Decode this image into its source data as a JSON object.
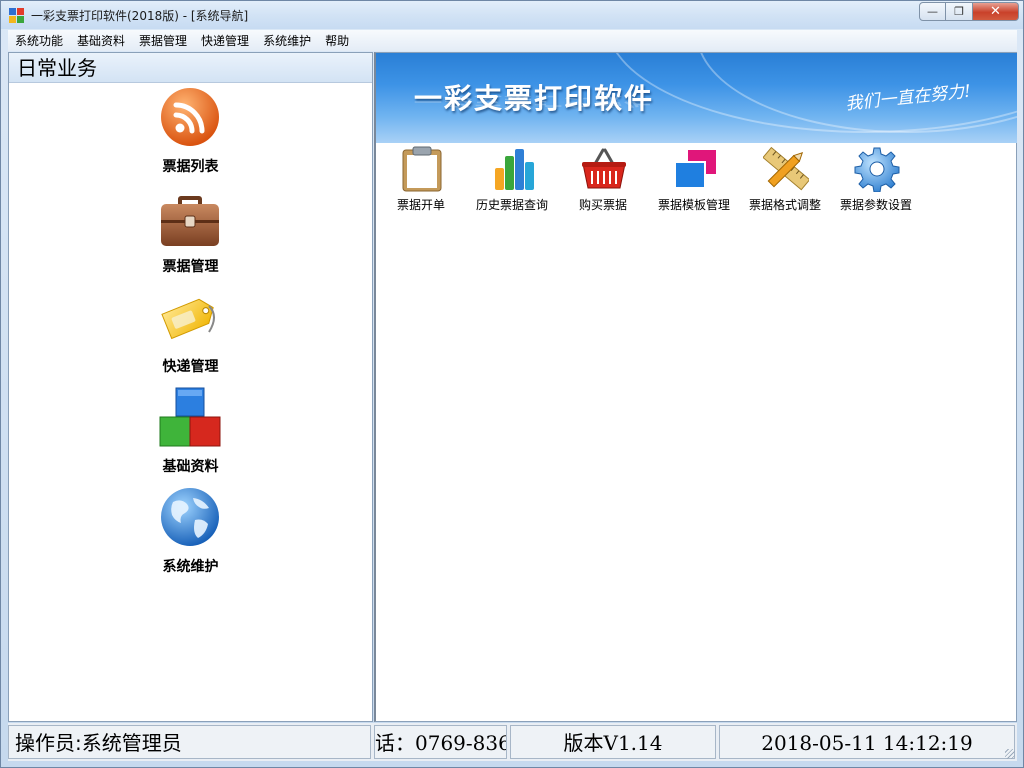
{
  "window": {
    "title": "一彩支票打印软件(2018版) - [系统导航]"
  },
  "menu": [
    "系统功能",
    "基础资料",
    "票据管理",
    "快递管理",
    "系统维护",
    "帮助"
  ],
  "left_panel": {
    "header": "日常业务",
    "items": [
      {
        "label": "票据列表",
        "icon": "rss-icon"
      },
      {
        "label": "票据管理",
        "icon": "briefcase-icon"
      },
      {
        "label": "快递管理",
        "icon": "tag-icon"
      },
      {
        "label": "基础资料",
        "icon": "blocks-icon"
      },
      {
        "label": "系统维护",
        "icon": "globe-icon"
      }
    ]
  },
  "banner": {
    "title": "一彩支票打印软件",
    "slogan": "我们一直在努力!"
  },
  "toolbar": [
    {
      "label": "票据开单",
      "icon": "clipboard-icon"
    },
    {
      "label": "历史票据查询",
      "icon": "bar-chart-icon"
    },
    {
      "label": "购买票据",
      "icon": "shopping-basket-icon"
    },
    {
      "label": "票据模板管理",
      "icon": "windows-icon"
    },
    {
      "label": "票据格式调整",
      "icon": "ruler-pencil-icon"
    },
    {
      "label": "票据参数设置",
      "icon": "gear-icon"
    }
  ],
  "status": {
    "operator": "操作员:系统管理员",
    "phone": "话：0769-836",
    "version": "版本V1.14",
    "datetime": "2018-05-11  14:12:19"
  },
  "colors": {
    "banner_blue": "#2a7fd6",
    "accent_orange": "#e8651e"
  }
}
